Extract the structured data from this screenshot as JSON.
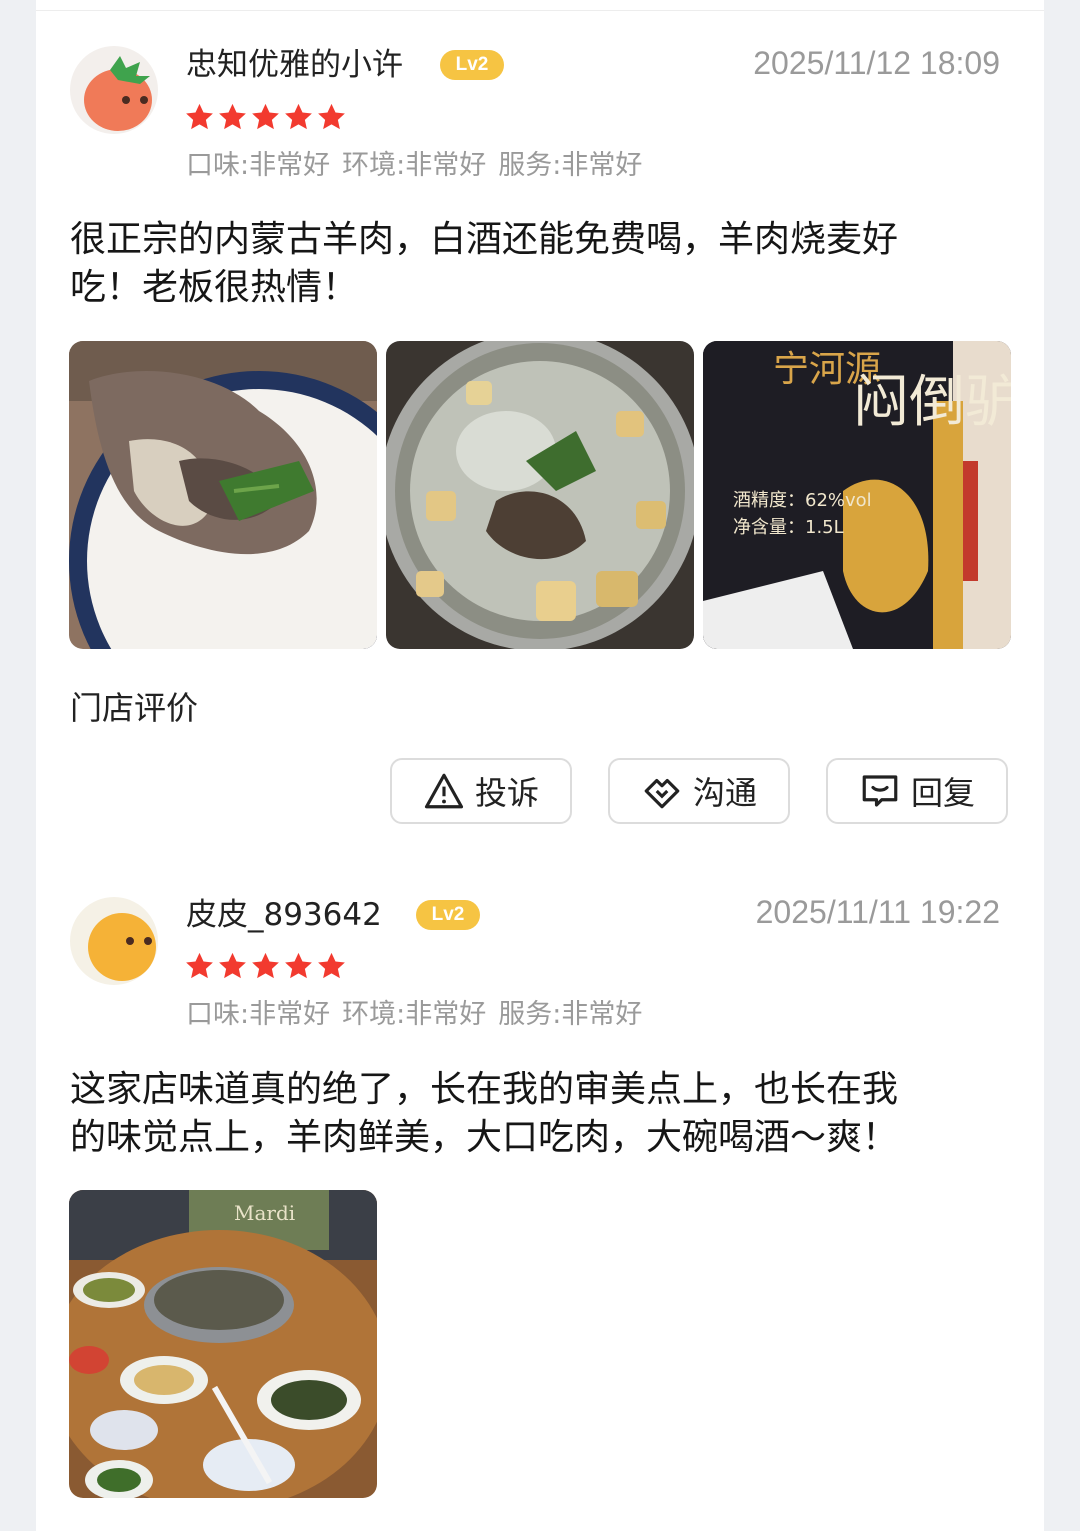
{
  "reviews": [
    {
      "user": "忠知优雅的小许",
      "level": "Lv2",
      "time": "2025/11/12 18:09",
      "stars": 5,
      "ratings": [
        "口味:非常好",
        "环境:非常好",
        "服务:非常好"
      ],
      "text_line1": "很正宗的内蒙古羊肉，白酒还能免费喝，羊肉烧麦好",
      "text_line2": "吃！老板很热情！",
      "photo3_texts": {
        "brand": "宁河源",
        "name": "闷倒驴",
        "abv": "酒精度：62%vol",
        "volume": "净含量：1.5L"
      }
    },
    {
      "user": "皮皮_893642",
      "level": "Lv2",
      "time": "2025/11/11 19:22",
      "stars": 5,
      "ratings": [
        "口味:非常好",
        "环境:非常好",
        "服务:非常好"
      ],
      "text_line1": "这家店味道真的绝了，长在我的审美点上，也长在我",
      "text_line2": "的味觉点上，羊肉鲜美，大口吃肉，大碗喝酒～爽！",
      "photo_texts": {
        "sign": "Mardi"
      }
    }
  ],
  "shop_review_label": "门店评价",
  "actions": {
    "complain": "投诉",
    "communicate": "沟通",
    "reply": "回复"
  },
  "colors": {
    "star": "#f23a2f",
    "badge": "#f6c443"
  }
}
